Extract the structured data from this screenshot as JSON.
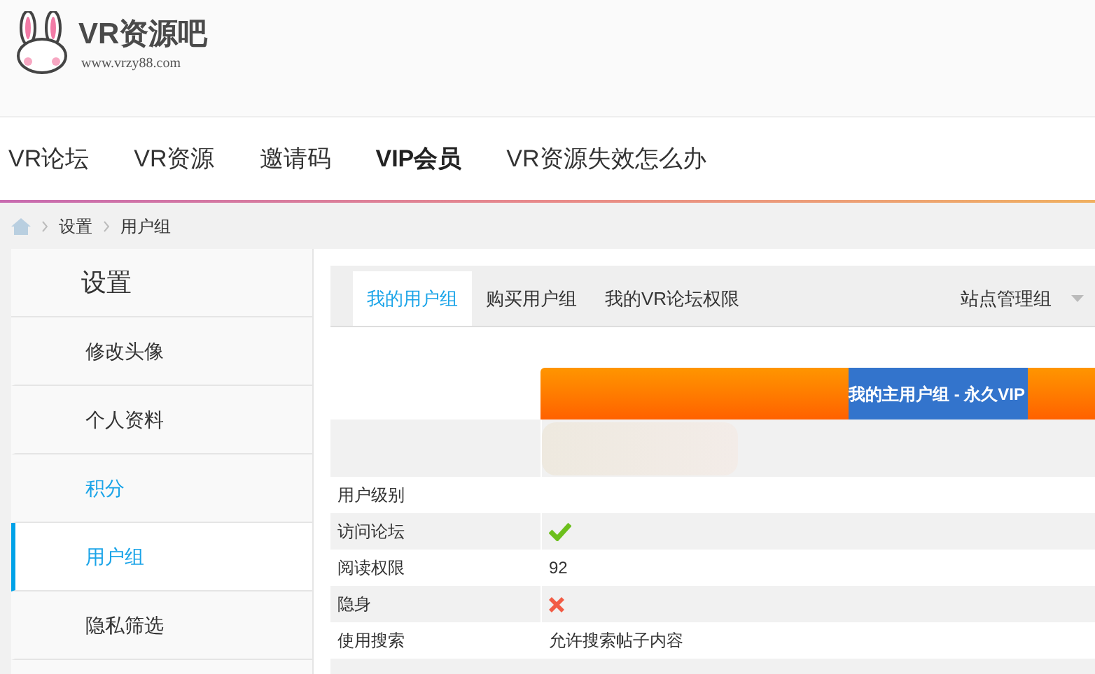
{
  "logo": {
    "name": "VR资源吧",
    "url": "www.vrzy88.com"
  },
  "nav": [
    {
      "label": "VR论坛",
      "selected": false
    },
    {
      "label": "VR资源",
      "selected": false
    },
    {
      "label": "邀请码",
      "selected": false
    },
    {
      "label": "VIP会员",
      "selected": true
    },
    {
      "label": "VR资源失效怎么办",
      "selected": false
    }
  ],
  "breadcrumb": [
    "设置",
    "用户组"
  ],
  "sidebar": {
    "title": "设置",
    "items": [
      {
        "label": "修改头像",
        "selected": false,
        "highlighted": false
      },
      {
        "label": "个人资料",
        "selected": false,
        "highlighted": false
      },
      {
        "label": "积分",
        "selected": false,
        "highlighted": true
      },
      {
        "label": "用户组",
        "selected": true,
        "highlighted": true
      },
      {
        "label": "隐私筛选",
        "selected": false,
        "highlighted": false
      }
    ]
  },
  "tabs": [
    {
      "label": "我的用户组",
      "selected": true
    },
    {
      "label": "购买用户组",
      "selected": false
    },
    {
      "label": "我的VR论坛权限",
      "selected": false
    }
  ],
  "group_select": {
    "value": "站点管理组"
  },
  "group_header": "我的主用户组 - 永久VIP",
  "rows": [
    {
      "label": "用户级别",
      "kind": "empty"
    },
    {
      "label": "访问论坛",
      "kind": "yes"
    },
    {
      "label": "阅读权限",
      "kind": "text",
      "value": "92"
    },
    {
      "label": "隐身",
      "kind": "no"
    },
    {
      "label": "使用搜索",
      "kind": "text",
      "value": "允许搜索帖子内容"
    }
  ]
}
